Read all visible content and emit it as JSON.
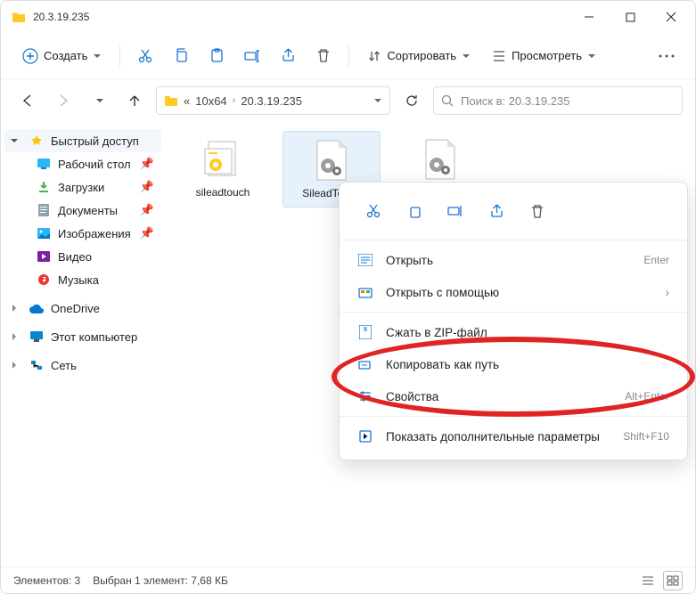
{
  "titlebar": {
    "title": "20.3.19.235"
  },
  "toolbar": {
    "create": "Создать",
    "sort": "Сортировать",
    "view": "Просмотреть"
  },
  "breadcrumb": {
    "parent": "10x64",
    "current": "20.3.19.235",
    "prefix": "«"
  },
  "search": {
    "placeholder": "Поиск в: 20.3.19.235"
  },
  "sidebar": {
    "quick": "Быстрый доступ",
    "desktop": "Рабочий стол",
    "downloads": "Загрузки",
    "documents": "Документы",
    "images": "Изображения",
    "video": "Видео",
    "music": "Музыка",
    "onedrive": "OneDrive",
    "thispc": "Этот компьютер",
    "network": "Сеть"
  },
  "files": {
    "f1": "sileadtouch",
    "f2": "SileadTouch",
    "f3": ""
  },
  "ctx": {
    "open": "Открыть",
    "open_sc": "Enter",
    "openwith": "Открыть с помощью",
    "zip": "Сжать в ZIP-файл",
    "copypath": "Копировать как путь",
    "props": "Свойства",
    "props_sc": "Alt+Enter",
    "more": "Показать дополнительные параметры",
    "more_sc": "Shift+F10"
  },
  "status": {
    "count": "Элементов: 3",
    "selected": "Выбран 1 элемент: 7,68 КБ"
  }
}
